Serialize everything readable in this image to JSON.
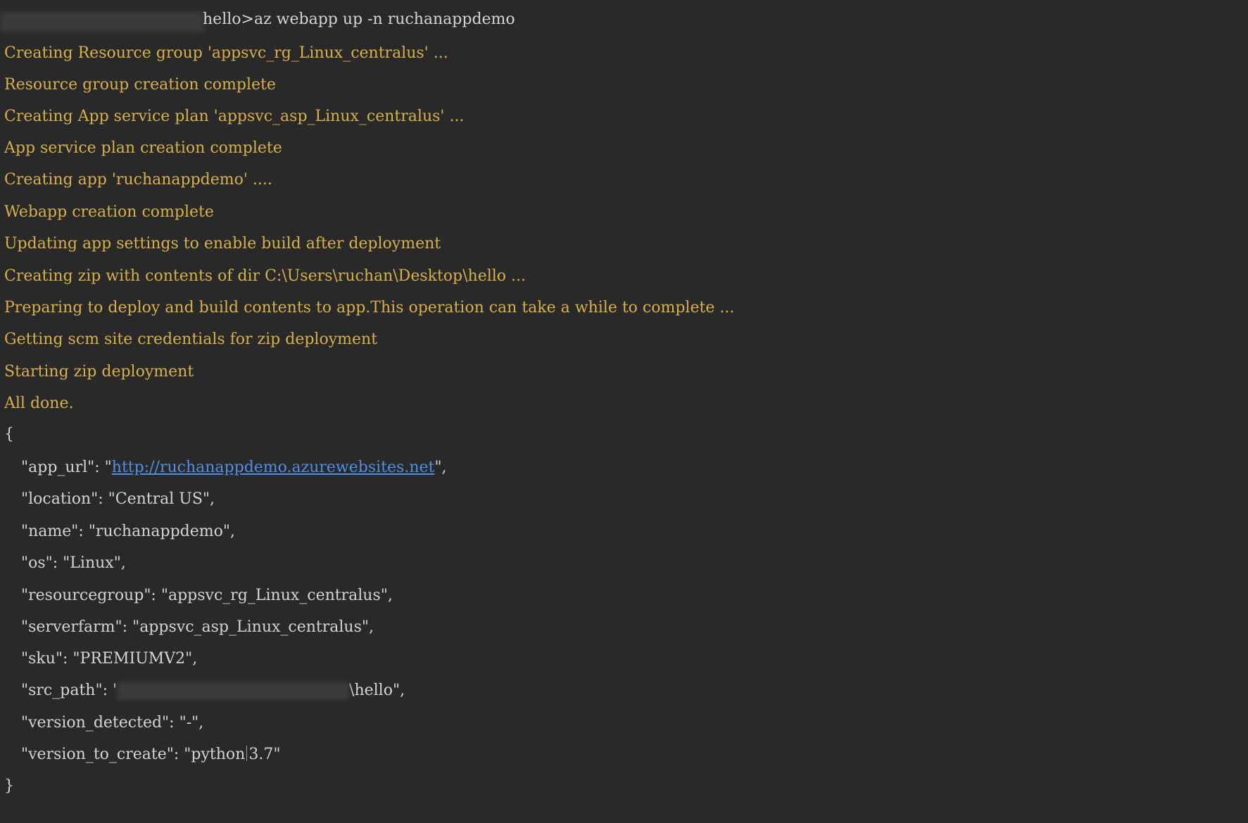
{
  "command": {
    "prompt_suffix": "hello>",
    "text": "az webapp up -n ruchanappdemo"
  },
  "log_lines": [
    "Creating Resource group 'appsvc_rg_Linux_centralus' ...",
    "Resource group creation complete",
    "Creating App service plan 'appsvc_asp_Linux_centralus' ...",
    "App service plan creation complete",
    "Creating app 'ruchanappdemo' ....",
    "Webapp creation complete",
    "Updating app settings to enable build after deployment",
    "Creating zip with contents of dir C:\\Users\\ruchan\\Desktop\\hello ...",
    "Preparing to deploy and build contents to app.This operation can take a while to complete ...",
    "Getting scm site credentials for zip deployment",
    "Starting zip deployment",
    "All done."
  ],
  "json_output": {
    "open_brace": "{",
    "close_brace": "}",
    "app_url_key": "\"app_url\": \"",
    "app_url_value": "http://ruchanappdemo.azurewebsites.net",
    "app_url_end": "\",",
    "location": "\"location\": \"Central US\",",
    "name": "\"name\": \"ruchanappdemo\",",
    "os": "\"os\": \"Linux\",",
    "resourcegroup": "\"resourcegroup\": \"appsvc_rg_Linux_centralus\",",
    "serverfarm": "\"serverfarm\": \"appsvc_asp_Linux_centralus\",",
    "sku": "\"sku\": \"PREMIUMV2\",",
    "src_path_key": "\"src_path\": '",
    "src_path_end": "\\hello\",",
    "version_detected": "\"version_detected\": \"-\",",
    "version_to_create_start": "\"version_to_create\": \"python",
    "version_to_create_end": "3.7\""
  },
  "colors": {
    "background": "#292929",
    "log_text": "#d8b04b",
    "default_text": "#d4d4d4",
    "link": "#4d8fe6"
  }
}
